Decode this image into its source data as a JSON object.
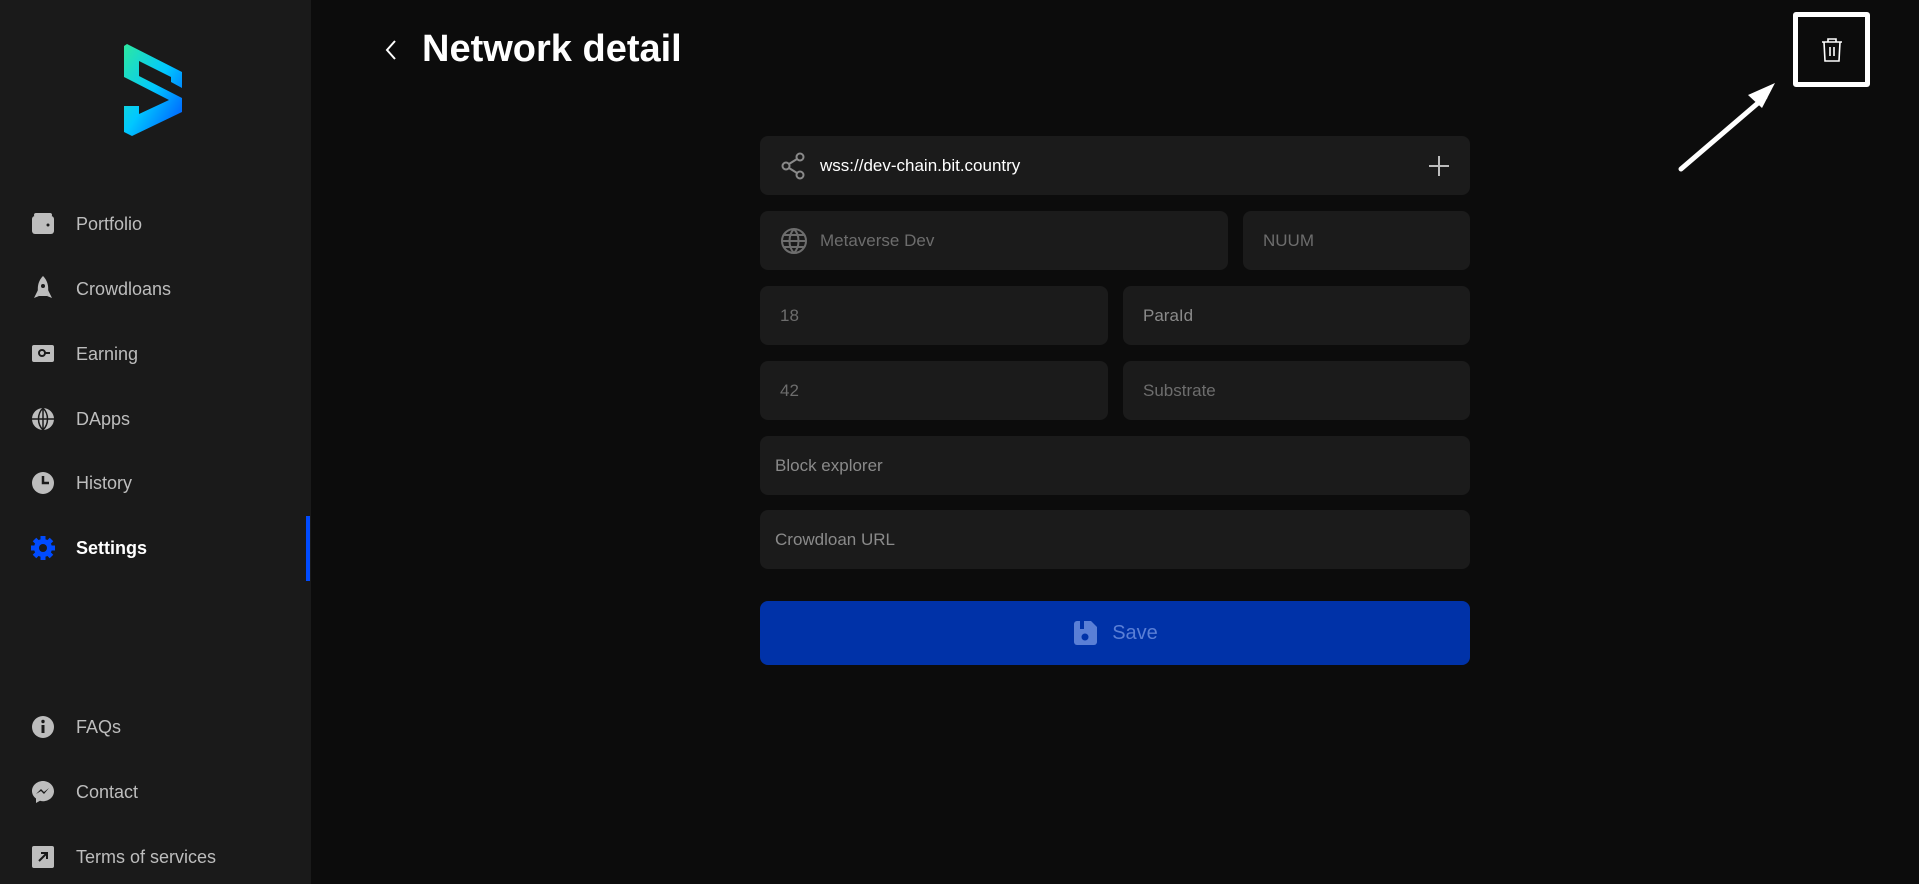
{
  "header": {
    "title": "Network detail"
  },
  "sidebar": {
    "items": [
      {
        "label": "Portfolio",
        "icon": "wallet-icon"
      },
      {
        "label": "Crowdloans",
        "icon": "rocket-icon"
      },
      {
        "label": "Earning",
        "icon": "safe-icon"
      },
      {
        "label": "DApps",
        "icon": "globe-icon"
      },
      {
        "label": "History",
        "icon": "clock-icon"
      },
      {
        "label": "Settings",
        "icon": "gear-icon",
        "active": true
      }
    ],
    "bottom": [
      {
        "label": "FAQs",
        "icon": "info-icon"
      },
      {
        "label": "Contact",
        "icon": "messenger-icon"
      },
      {
        "label": "Terms of services",
        "icon": "external-link-icon"
      }
    ]
  },
  "form": {
    "provider_url": "wss://dev-chain.bit.country",
    "network_name": "Metaverse Dev",
    "symbol": "NUUM",
    "decimals": "18",
    "para_id_placeholder": "ParaId",
    "ss58": "42",
    "chain_type": "Substrate",
    "block_explorer_placeholder": "Block explorer",
    "crowdloan_url_placeholder": "Crowdloan URL",
    "save_label": "Save"
  },
  "colors": {
    "accent": "#004bff",
    "save_bg": "#0032a8",
    "sidebar_bg": "#1a1a1a",
    "page_bg": "#0c0c0c"
  }
}
